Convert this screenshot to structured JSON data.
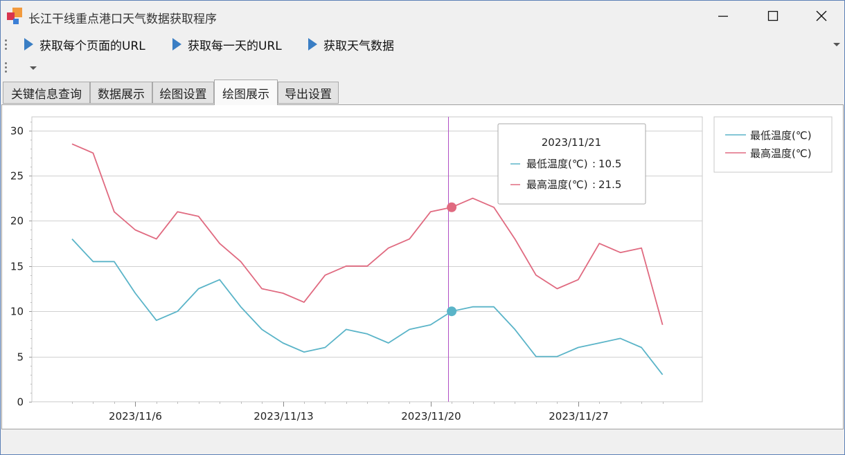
{
  "window": {
    "title": "长江干线重点港口天气数据获取程序"
  },
  "toolbar": {
    "buttons": [
      {
        "label": "获取每个页面的URL"
      },
      {
        "label": "获取每一天的URL"
      },
      {
        "label": "获取天气数据"
      }
    ]
  },
  "tabs": [
    {
      "label": "关键信息查询",
      "active": false
    },
    {
      "label": "数据展示",
      "active": false
    },
    {
      "label": "绘图设置",
      "active": false
    },
    {
      "label": "绘图展示",
      "active": true
    },
    {
      "label": "导出设置",
      "active": false
    }
  ],
  "colors": {
    "low_series": "#5ab4c8",
    "high_series": "#e06a80",
    "crosshair": "#b14fc5"
  },
  "chart_data": {
    "type": "line",
    "x": [
      "2023/11/3",
      "2023/11/4",
      "2023/11/5",
      "2023/11/6",
      "2023/11/7",
      "2023/11/8",
      "2023/11/9",
      "2023/11/10",
      "2023/11/11",
      "2023/11/12",
      "2023/11/13",
      "2023/11/14",
      "2023/11/15",
      "2023/11/16",
      "2023/11/17",
      "2023/11/18",
      "2023/11/19",
      "2023/11/20",
      "2023/11/21",
      "2023/11/22",
      "2023/11/23",
      "2023/11/24",
      "2023/11/25",
      "2023/11/26",
      "2023/11/27",
      "2023/11/28",
      "2023/11/29",
      "2023/11/30",
      "2023/12/1"
    ],
    "series": [
      {
        "name": "最低温度(℃)",
        "values": [
          18,
          15.5,
          15.5,
          12,
          9,
          10,
          12.5,
          13.5,
          10.5,
          8,
          6.5,
          5.5,
          6,
          8,
          7.5,
          6.5,
          8,
          8.5,
          10,
          10.5,
          10.5,
          8,
          5,
          5,
          6,
          6.5,
          7,
          6,
          3
        ]
      },
      {
        "name": "最高温度(℃)",
        "values": [
          28.5,
          27.5,
          21,
          19,
          18,
          21,
          20.5,
          17.5,
          15.5,
          12.5,
          12,
          11,
          14,
          15,
          15,
          17,
          18,
          21,
          21.5,
          22.5,
          21.5,
          18,
          14,
          12.5,
          13.5,
          17.5,
          16.5,
          17,
          8.5
        ]
      }
    ],
    "x_tick_labels": [
      "2023/11/6",
      "2023/11/13",
      "2023/11/20",
      "2023/11/27"
    ],
    "y_ticks": [
      0,
      5,
      10,
      15,
      20,
      25,
      30
    ],
    "ylim": [
      0,
      31.5
    ],
    "grid": true,
    "legend_position": "top-right-outside",
    "crosshair": {
      "date": "2023/11/21",
      "entries": [
        {
          "label": "最低温度(℃)",
          "value": "10.5"
        },
        {
          "label": "最高温度(℃)",
          "value": "21.5"
        }
      ]
    }
  }
}
